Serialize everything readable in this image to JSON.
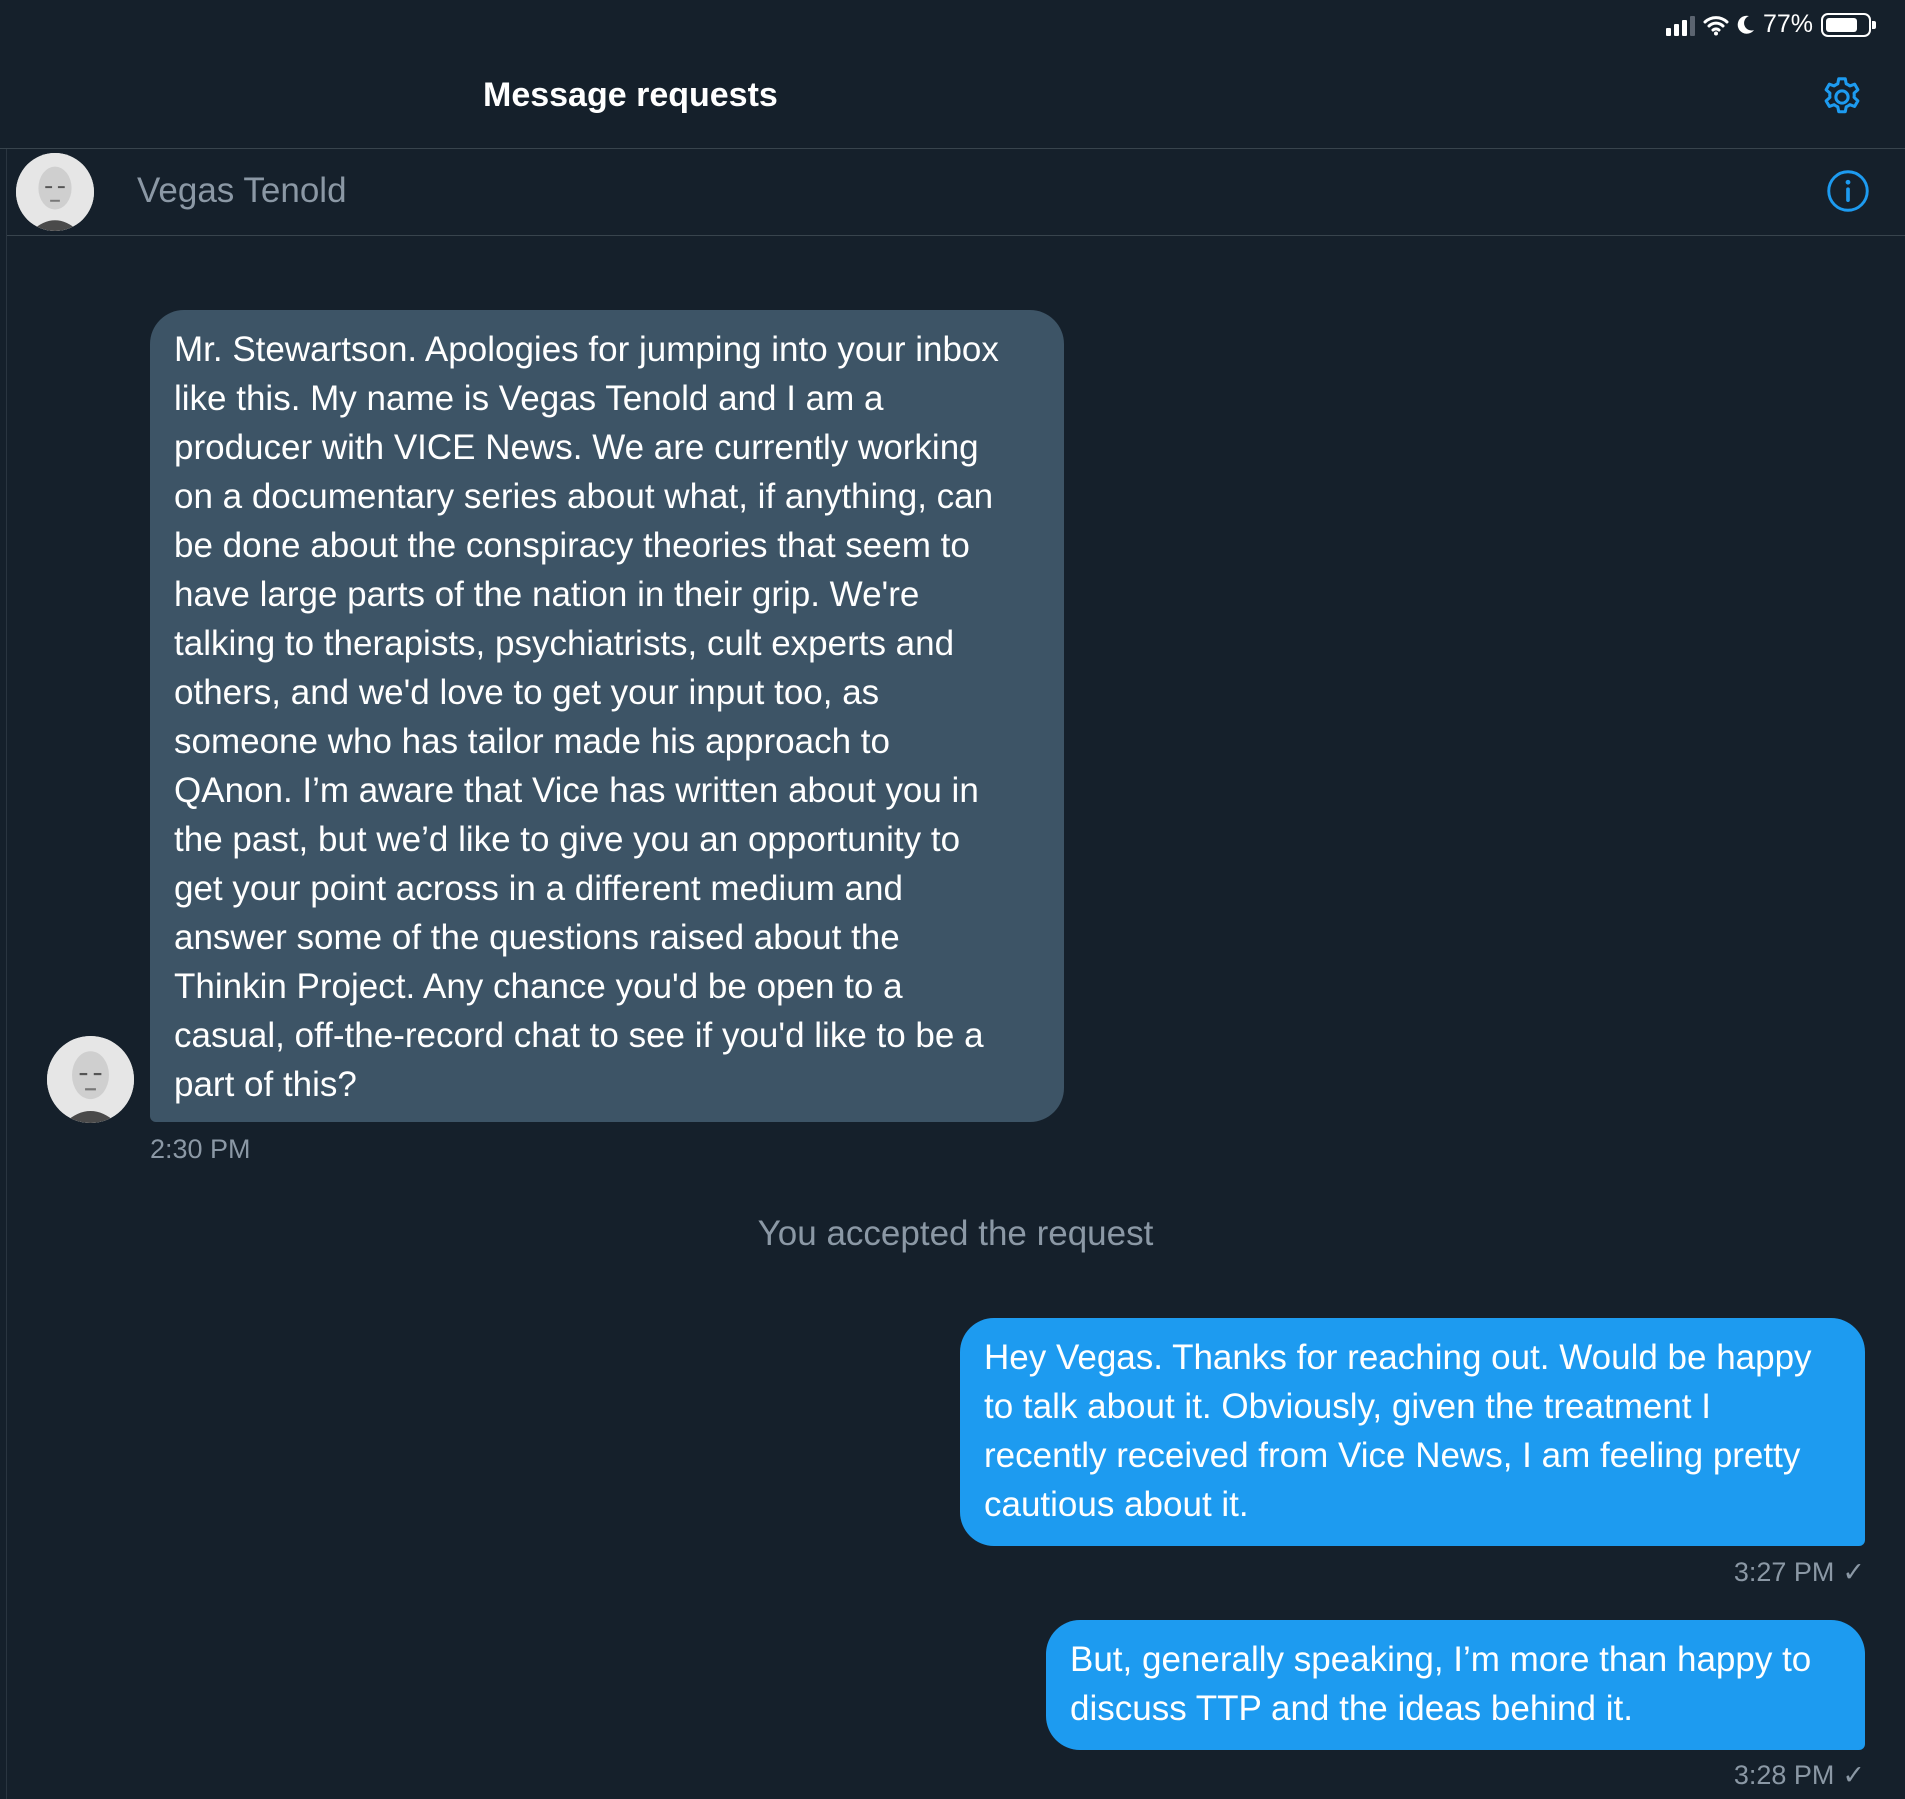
{
  "status_bar": {
    "battery_level": "77%",
    "battery_fraction": 0.77,
    "icons": [
      "cellular-signal-icon",
      "wifi-icon",
      "moon-icon",
      "battery-icon"
    ]
  },
  "header": {
    "title": "Message requests",
    "settings_icon": "gear-icon"
  },
  "conversation": {
    "name": "Vegas Tenold",
    "info_icon": "info-icon"
  },
  "messages": [
    {
      "direction": "incoming",
      "lines": [
        "Mr. Stewartson. Apologies for jumping into your inbox",
        "like this. My name is Vegas Tenold and I am a",
        "producer with VICE News. We are currently working",
        "on a documentary series about what, if anything, can",
        "be done about the conspiracy theories that seem to",
        "have large parts of the nation in their grip. We're",
        "talking to therapists, psychiatrists, cult experts and",
        "others, and we'd love to get your input too, as",
        "someone who has tailor made his approach to",
        "QAnon.  I’m aware that Vice has written about you in",
        "the past, but we’d like to give you an opportunity to",
        "get your point across in a different medium and",
        "answer some of the questions raised about the",
        "Thinkin Project. Any chance you'd be open to a",
        "casual, off-the-record chat to see if you'd like to be a",
        "part of this?"
      ],
      "time": "2:30 PM"
    },
    {
      "direction": "outgoing",
      "lines": [
        "Hey Vegas. Thanks for reaching out. Would be happy",
        "to talk about it. Obviously, given the treatment I",
        "recently received from Vice News, I am feeling pretty",
        "cautious about it."
      ],
      "time": "3:27 PM",
      "check": "✓"
    },
    {
      "direction": "outgoing",
      "lines": [
        "But, generally speaking, I’m more than happy to",
        "discuss TTP and the ideas behind it."
      ],
      "time": "3:28 PM",
      "check": "✓"
    }
  ],
  "system_note": "You accepted the request",
  "colors": {
    "background": "#15202b",
    "incoming_bubble": "#3d5466",
    "outgoing_bubble": "#1d9bf0",
    "accent": "#1d9bf0",
    "muted_text": "#8b98a5",
    "divider": "#38444d"
  }
}
